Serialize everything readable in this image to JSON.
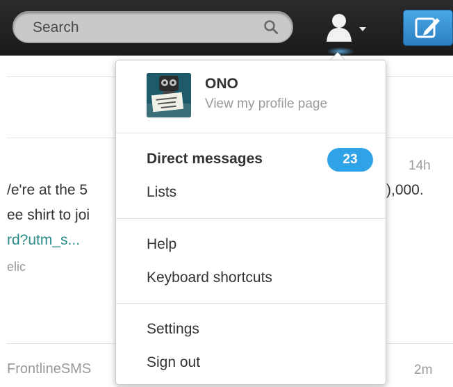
{
  "header": {
    "search_placeholder": "Search",
    "icons": {
      "search": "search-icon",
      "user": "user-icon",
      "caret": "chevron-down-icon",
      "compose": "compose-icon"
    },
    "accent": "#2fa3e6"
  },
  "timeline": {
    "fragments": [
      {
        "text": "/e're at the 5",
        "time": "14h"
      },
      {
        "text": "ee shirt to joi"
      },
      {
        "text": "rd?utm_s..."
      },
      {
        "text": "elic"
      },
      {
        "text": "),000."
      },
      {
        "text": "FrontlineSMS",
        "time": "2m"
      }
    ]
  },
  "dropdown": {
    "profile": {
      "name": "ONO",
      "subtitle": "View my profile page"
    },
    "items": [
      {
        "label": "Direct messages",
        "badge": "23"
      },
      {
        "label": "Lists"
      },
      {
        "label": "Help"
      },
      {
        "label": "Keyboard shortcuts"
      },
      {
        "label": "Settings"
      },
      {
        "label": "Sign out"
      }
    ]
  }
}
